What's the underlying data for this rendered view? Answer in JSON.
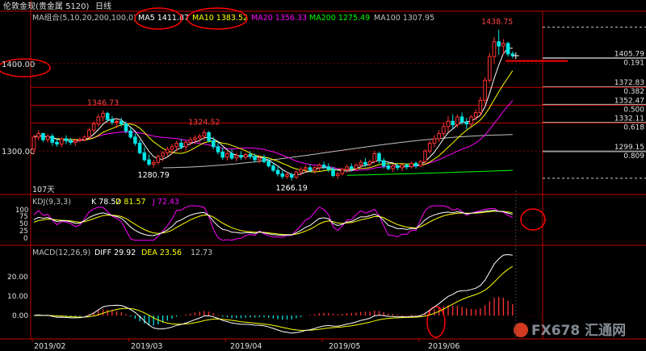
{
  "title_bar": {
    "name": "伦敦金现(贵金属 5120)",
    "period": "日线"
  },
  "ma_legend": [
    {
      "label": "MA组合(5,10,20,200,100,0)",
      "color": "#c0c0c0"
    },
    {
      "label": "MA5 1411.87",
      "color": "#ffffff"
    },
    {
      "label": "MA10 1383.52",
      "color": "#ffff00"
    },
    {
      "label": "MA20 1356.33",
      "color": "#ff00ff"
    },
    {
      "label": "MA200 1275.49",
      "color": "#00ff00"
    },
    {
      "label": "MA100 1307.95",
      "color": "#c0c0c0"
    }
  ],
  "price_axis_labels": [
    "1400.00",
    "1300.00"
  ],
  "price_annotations": [
    {
      "text": "1438.75",
      "price": 1438.75,
      "idx": 101,
      "color": "#ff4040"
    },
    {
      "text": "1346.73",
      "price": 1346.73,
      "idx": 15,
      "color": "#ff4040"
    },
    {
      "text": "1324.52",
      "price": 1324.52,
      "idx": 37,
      "color": "#ff4040"
    },
    {
      "text": "1280.79",
      "price": 1280.79,
      "idx": 26,
      "color": "#ffffff"
    },
    {
      "text": "1266.19",
      "price": 1266.19,
      "idx": 56,
      "color": "#ffffff"
    }
  ],
  "fib_levels": [
    {
      "price": 1405.79,
      "ratio": "0.191"
    },
    {
      "price": 1372.83,
      "ratio": "0.382"
    },
    {
      "price": 1352.47,
      "ratio": "0.500"
    },
    {
      "price": 1332.11,
      "ratio": "0.618"
    },
    {
      "price": 1299.15,
      "ratio": "0.809"
    }
  ],
  "days_label": "107天",
  "kdj": {
    "label": "KDJ(9,3,3)",
    "k": "K 78.52",
    "d": "D 81.57",
    "j": "J 72.43",
    "axis": [
      "100",
      "75",
      "50",
      "25",
      "0"
    ]
  },
  "macd": {
    "label": "MACD(12,26,9)",
    "diff": "DIFF 29.92",
    "dea": "DEA 23.56",
    "macd": "12.73",
    "axis": [
      "20.00",
      "10.00",
      "0.00"
    ]
  },
  "date_labels": [
    "2019/02",
    "2019/03",
    "2019/04",
    "2019/05",
    "2019/06"
  ],
  "watermark": "FX678 汇通网",
  "colors": {
    "up": "#ff3232",
    "down": "#00e5e5",
    "ma5": "#ffffff",
    "ma10": "#ffff00",
    "ma20": "#ff00ff",
    "ma100": "#c0c0c0",
    "ma200": "#00ff00",
    "axis": "#c00000"
  },
  "chart_data": {
    "type": "candlestick",
    "ylim": [
      1255,
      1445
    ],
    "candles": [
      {
        "o": 1302,
        "h": 1319,
        "l": 1296,
        "c": 1316
      },
      {
        "o": 1316,
        "h": 1324,
        "l": 1312,
        "c": 1320
      },
      {
        "o": 1320,
        "h": 1321,
        "l": 1310,
        "c": 1313
      },
      {
        "o": 1313,
        "h": 1319,
        "l": 1310,
        "c": 1317
      },
      {
        "o": 1317,
        "h": 1320,
        "l": 1306,
        "c": 1310
      },
      {
        "o": 1310,
        "h": 1314,
        "l": 1305,
        "c": 1308
      },
      {
        "o": 1308,
        "h": 1316,
        "l": 1304,
        "c": 1314
      },
      {
        "o": 1314,
        "h": 1318,
        "l": 1308,
        "c": 1312
      },
      {
        "o": 1312,
        "h": 1315,
        "l": 1307,
        "c": 1310
      },
      {
        "o": 1310,
        "h": 1314,
        "l": 1306,
        "c": 1312
      },
      {
        "o": 1312,
        "h": 1316,
        "l": 1310,
        "c": 1313
      },
      {
        "o": 1313,
        "h": 1318,
        "l": 1311,
        "c": 1316
      },
      {
        "o": 1316,
        "h": 1326,
        "l": 1314,
        "c": 1324
      },
      {
        "o": 1324,
        "h": 1334,
        "l": 1320,
        "c": 1331
      },
      {
        "o": 1331,
        "h": 1342,
        "l": 1328,
        "c": 1339
      },
      {
        "o": 1339,
        "h": 1346.73,
        "l": 1334,
        "c": 1343
      },
      {
        "o": 1343,
        "h": 1345,
        "l": 1333,
        "c": 1336
      },
      {
        "o": 1336,
        "h": 1340,
        "l": 1330,
        "c": 1333
      },
      {
        "o": 1333,
        "h": 1337,
        "l": 1326,
        "c": 1334
      },
      {
        "o": 1334,
        "h": 1338,
        "l": 1328,
        "c": 1331
      },
      {
        "o": 1331,
        "h": 1334,
        "l": 1320,
        "c": 1323
      },
      {
        "o": 1323,
        "h": 1327,
        "l": 1314,
        "c": 1316
      },
      {
        "o": 1316,
        "h": 1320,
        "l": 1306,
        "c": 1309
      },
      {
        "o": 1309,
        "h": 1313,
        "l": 1296,
        "c": 1298
      },
      {
        "o": 1298,
        "h": 1304,
        "l": 1288,
        "c": 1290
      },
      {
        "o": 1290,
        "h": 1296,
        "l": 1283,
        "c": 1285
      },
      {
        "o": 1285,
        "h": 1290,
        "l": 1280.79,
        "c": 1287
      },
      {
        "o": 1287,
        "h": 1296,
        "l": 1285,
        "c": 1294
      },
      {
        "o": 1294,
        "h": 1300,
        "l": 1288,
        "c": 1298
      },
      {
        "o": 1298,
        "h": 1305,
        "l": 1294,
        "c": 1302
      },
      {
        "o": 1302,
        "h": 1308,
        "l": 1296,
        "c": 1305
      },
      {
        "o": 1305,
        "h": 1312,
        "l": 1300,
        "c": 1309
      },
      {
        "o": 1309,
        "h": 1314,
        "l": 1302,
        "c": 1305
      },
      {
        "o": 1305,
        "h": 1312,
        "l": 1300,
        "c": 1310
      },
      {
        "o": 1310,
        "h": 1316,
        "l": 1306,
        "c": 1313
      },
      {
        "o": 1313,
        "h": 1318,
        "l": 1308,
        "c": 1315
      },
      {
        "o": 1315,
        "h": 1320,
        "l": 1310,
        "c": 1317
      },
      {
        "o": 1317,
        "h": 1324.52,
        "l": 1312,
        "c": 1321
      },
      {
        "o": 1321,
        "h": 1323,
        "l": 1310,
        "c": 1312
      },
      {
        "o": 1312,
        "h": 1316,
        "l": 1302,
        "c": 1305
      },
      {
        "o": 1305,
        "h": 1310,
        "l": 1296,
        "c": 1299
      },
      {
        "o": 1299,
        "h": 1304,
        "l": 1290,
        "c": 1293
      },
      {
        "o": 1293,
        "h": 1300,
        "l": 1289,
        "c": 1297
      },
      {
        "o": 1297,
        "h": 1302,
        "l": 1290,
        "c": 1292
      },
      {
        "o": 1292,
        "h": 1298,
        "l": 1288,
        "c": 1295
      },
      {
        "o": 1295,
        "h": 1300,
        "l": 1290,
        "c": 1293
      },
      {
        "o": 1293,
        "h": 1298,
        "l": 1290,
        "c": 1296
      },
      {
        "o": 1296,
        "h": 1300,
        "l": 1291,
        "c": 1294
      },
      {
        "o": 1294,
        "h": 1297,
        "l": 1287,
        "c": 1290
      },
      {
        "o": 1290,
        "h": 1295,
        "l": 1286,
        "c": 1292
      },
      {
        "o": 1292,
        "h": 1296,
        "l": 1286,
        "c": 1288
      },
      {
        "o": 1288,
        "h": 1292,
        "l": 1281,
        "c": 1283
      },
      {
        "o": 1283,
        "h": 1287,
        "l": 1276,
        "c": 1278
      },
      {
        "o": 1278,
        "h": 1282,
        "l": 1271,
        "c": 1274
      },
      {
        "o": 1274,
        "h": 1278,
        "l": 1268,
        "c": 1271
      },
      {
        "o": 1271,
        "h": 1276,
        "l": 1268,
        "c": 1273
      },
      {
        "o": 1273,
        "h": 1275,
        "l": 1266.19,
        "c": 1270
      },
      {
        "o": 1270,
        "h": 1278,
        "l": 1268,
        "c": 1276
      },
      {
        "o": 1276,
        "h": 1282,
        "l": 1272,
        "c": 1279
      },
      {
        "o": 1279,
        "h": 1284,
        "l": 1275,
        "c": 1281
      },
      {
        "o": 1281,
        "h": 1285,
        "l": 1276,
        "c": 1278
      },
      {
        "o": 1278,
        "h": 1283,
        "l": 1274,
        "c": 1281
      },
      {
        "o": 1281,
        "h": 1286,
        "l": 1277,
        "c": 1284
      },
      {
        "o": 1284,
        "h": 1288,
        "l": 1279,
        "c": 1282
      },
      {
        "o": 1282,
        "h": 1286,
        "l": 1276,
        "c": 1279
      },
      {
        "o": 1279,
        "h": 1282,
        "l": 1270,
        "c": 1272
      },
      {
        "o": 1272,
        "h": 1276,
        "l": 1268,
        "c": 1274
      },
      {
        "o": 1274,
        "h": 1281,
        "l": 1272,
        "c": 1279
      },
      {
        "o": 1279,
        "h": 1284,
        "l": 1275,
        "c": 1282
      },
      {
        "o": 1282,
        "h": 1286,
        "l": 1277,
        "c": 1280
      },
      {
        "o": 1280,
        "h": 1286,
        "l": 1277,
        "c": 1284
      },
      {
        "o": 1284,
        "h": 1290,
        "l": 1280,
        "c": 1287
      },
      {
        "o": 1287,
        "h": 1292,
        "l": 1282,
        "c": 1285
      },
      {
        "o": 1285,
        "h": 1290,
        "l": 1281,
        "c": 1288
      },
      {
        "o": 1288,
        "h": 1300,
        "l": 1286,
        "c": 1297
      },
      {
        "o": 1297,
        "h": 1299,
        "l": 1286,
        "c": 1289
      },
      {
        "o": 1289,
        "h": 1292,
        "l": 1280,
        "c": 1283
      },
      {
        "o": 1283,
        "h": 1287,
        "l": 1278,
        "c": 1280
      },
      {
        "o": 1280,
        "h": 1285,
        "l": 1276,
        "c": 1283
      },
      {
        "o": 1283,
        "h": 1286,
        "l": 1278,
        "c": 1281
      },
      {
        "o": 1281,
        "h": 1285,
        "l": 1277,
        "c": 1284
      },
      {
        "o": 1284,
        "h": 1286,
        "l": 1279,
        "c": 1282
      },
      {
        "o": 1282,
        "h": 1288,
        "l": 1280,
        "c": 1286
      },
      {
        "o": 1286,
        "h": 1288,
        "l": 1280,
        "c": 1283
      },
      {
        "o": 1283,
        "h": 1290,
        "l": 1282,
        "c": 1288
      },
      {
        "o": 1288,
        "h": 1302,
        "l": 1286,
        "c": 1300
      },
      {
        "o": 1300,
        "h": 1312,
        "l": 1297,
        "c": 1309
      },
      {
        "o": 1309,
        "h": 1318,
        "l": 1304,
        "c": 1314
      },
      {
        "o": 1314,
        "h": 1324,
        "l": 1310,
        "c": 1320
      },
      {
        "o": 1320,
        "h": 1332,
        "l": 1316,
        "c": 1328
      },
      {
        "o": 1328,
        "h": 1340,
        "l": 1322,
        "c": 1334
      },
      {
        "o": 1334,
        "h": 1342,
        "l": 1326,
        "c": 1330
      },
      {
        "o": 1330,
        "h": 1342,
        "l": 1327,
        "c": 1339
      },
      {
        "o": 1339,
        "h": 1344,
        "l": 1330,
        "c": 1333
      },
      {
        "o": 1333,
        "h": 1338,
        "l": 1325,
        "c": 1331
      },
      {
        "o": 1331,
        "h": 1341,
        "l": 1328,
        "c": 1339
      },
      {
        "o": 1339,
        "h": 1348,
        "l": 1335,
        "c": 1344
      },
      {
        "o": 1344,
        "h": 1362,
        "l": 1340,
        "c": 1358
      },
      {
        "o": 1358,
        "h": 1384,
        "l": 1354,
        "c": 1381
      },
      {
        "o": 1381,
        "h": 1412,
        "l": 1378,
        "c": 1408
      },
      {
        "o": 1408,
        "h": 1430,
        "l": 1400,
        "c": 1425
      },
      {
        "o": 1425,
        "h": 1438.75,
        "l": 1410,
        "c": 1420
      },
      {
        "o": 1420,
        "h": 1428,
        "l": 1410,
        "c": 1423
      },
      {
        "o": 1423,
        "h": 1425,
        "l": 1408,
        "c": 1411
      },
      {
        "o": 1411,
        "h": 1414,
        "l": 1406,
        "c": 1409
      }
    ]
  }
}
